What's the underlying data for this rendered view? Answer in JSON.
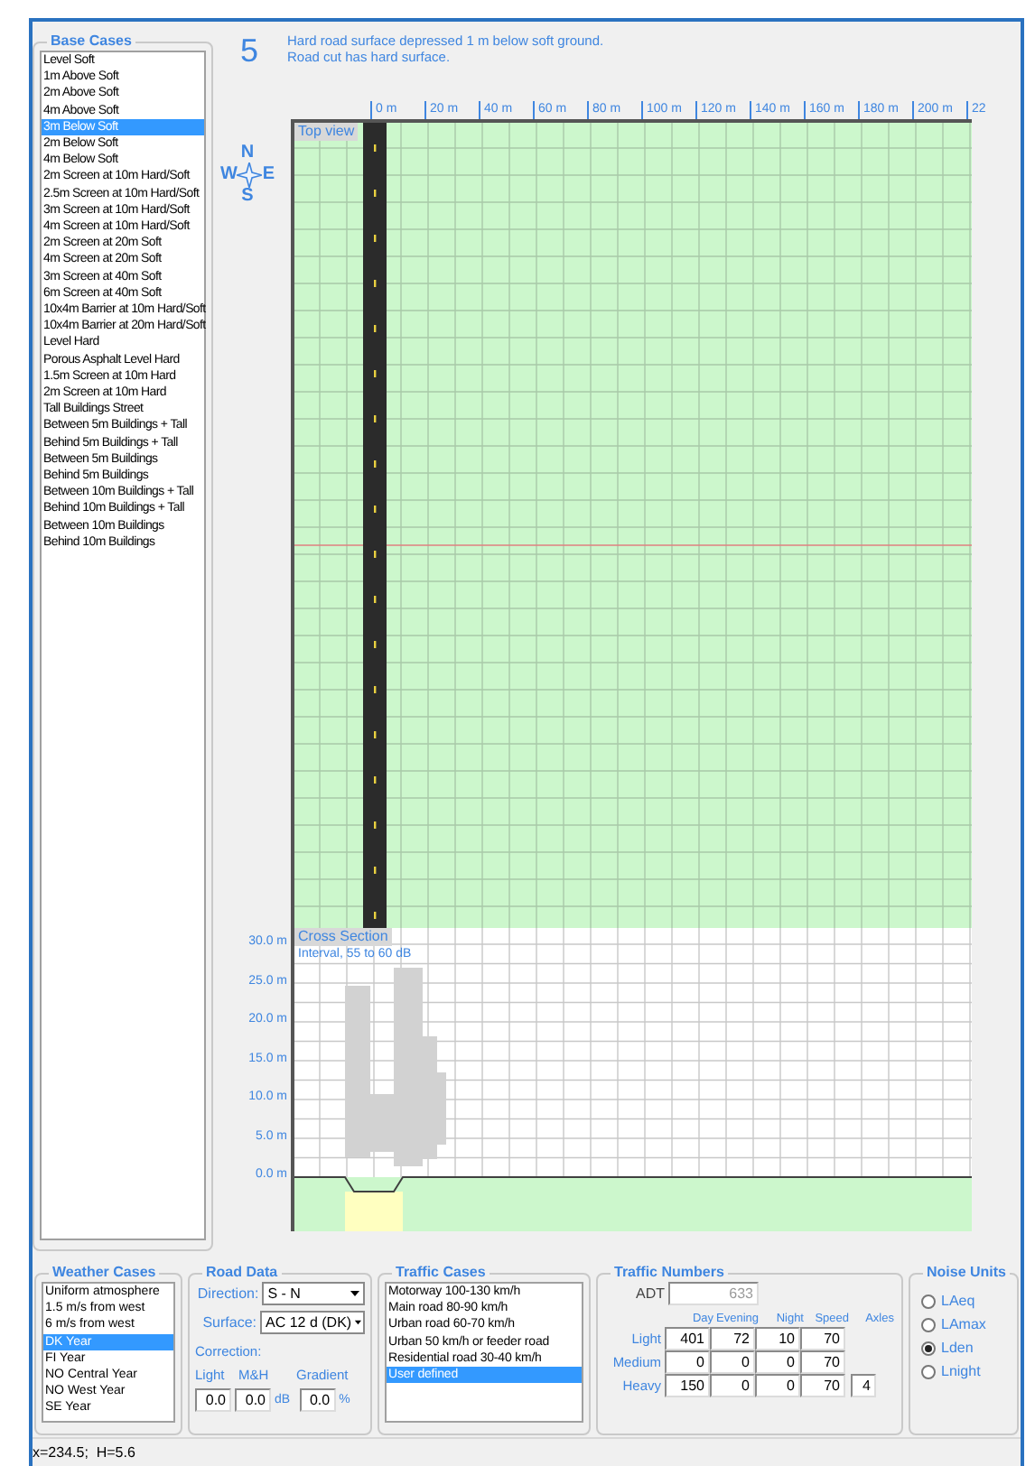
{
  "base_cases": {
    "title": "Base Cases",
    "items": [
      {
        "label": "Level Soft",
        "selected": false
      },
      {
        "label": "1m Above Soft",
        "selected": false
      },
      {
        "label": "2m Above Soft",
        "selected": false
      },
      {
        "label": "4m Above Soft",
        "selected": false
      },
      {
        "label": "3m Below Soft",
        "selected": true
      },
      {
        "label": "2m Below Soft",
        "selected": false
      },
      {
        "label": "4m Below Soft",
        "selected": false
      },
      {
        "label": "2m Screen at 10m Hard/Soft",
        "selected": false
      },
      {
        "label": "2.5m Screen at 10m Hard/Soft",
        "selected": false
      },
      {
        "label": "3m Screen at 10m Hard/Soft",
        "selected": false
      },
      {
        "label": "4m Screen at 10m Hard/Soft",
        "selected": false
      },
      {
        "label": "2m Screen at 20m Soft",
        "selected": false
      },
      {
        "label": "4m Screen at 20m Soft",
        "selected": false
      },
      {
        "label": "3m Screen at 40m Soft",
        "selected": false
      },
      {
        "label": "6m Screen at 40m Soft",
        "selected": false
      },
      {
        "label": "10x4m Barrier at 10m Hard/Soft",
        "selected": false
      },
      {
        "label": "10x4m Barrier at 20m Hard/Soft",
        "selected": false
      },
      {
        "label": "Level Hard",
        "selected": false
      },
      {
        "label": "Porous Asphalt Level Hard",
        "selected": false
      },
      {
        "label": "1.5m Screen at 10m Hard",
        "selected": false
      },
      {
        "label": "2m Screen at 10m Hard",
        "selected": false
      },
      {
        "label": "Tall Buildings Street",
        "selected": false
      },
      {
        "label": "Between 5m Buildings + Tall",
        "selected": false
      },
      {
        "label": "Behind  5m Buildings + Tall",
        "selected": false
      },
      {
        "label": "Between 5m Buildings",
        "selected": false
      },
      {
        "label": "Behind  5m Buildings",
        "selected": false
      },
      {
        "label": "Between 10m Buildings + Tall",
        "selected": false
      },
      {
        "label": "Behind  10m Buildings + Tall",
        "selected": false
      },
      {
        "label": "Between 10m Buildings",
        "selected": false
      },
      {
        "label": "Behind  10m Buildings",
        "selected": false
      }
    ]
  },
  "scenario": {
    "number": "5",
    "description": [
      "Hard road surface depressed 1 m below soft ground.",
      "Road cut has hard surface."
    ]
  },
  "compass": {
    "north": "N",
    "west": "W",
    "east": "E",
    "south": "S"
  },
  "top_view": {
    "label": "Top view",
    "ruler": [
      "0 m",
      "20 m",
      "40 m",
      "60 m",
      "80 m",
      "100 m",
      "120 m",
      "140 m",
      "160 m",
      "180 m",
      "200 m",
      "22"
    ]
  },
  "cross_section": {
    "title": "Cross Section",
    "interval": "Interval, 55 to 60 dB",
    "y_labels": [
      "30.0 m",
      "25.0 m",
      "20.0 m",
      "15.0 m",
      "10.0 m",
      "5.0 m",
      "0.0 m"
    ]
  },
  "weather_cases": {
    "title": "Weather Cases",
    "items": [
      {
        "label": "Uniform atmosphere",
        "selected": false
      },
      {
        "label": "1.5 m/s from west",
        "selected": false
      },
      {
        "label": "6 m/s from west",
        "selected": false
      },
      {
        "label": "DK Year",
        "selected": true
      },
      {
        "label": "FI Year",
        "selected": false
      },
      {
        "label": "NO Central Year",
        "selected": false
      },
      {
        "label": "NO West Year",
        "selected": false
      },
      {
        "label": "SE Year",
        "selected": false
      }
    ]
  },
  "road_data": {
    "title": "Road Data",
    "direction_label": "Direction:",
    "direction": "S - N",
    "surface_label": "Surface:",
    "surface": "AC 12 d (DK)",
    "correction_label": "Correction:",
    "columns": [
      "Light",
      "M&H",
      "Gradient"
    ],
    "light": "0.0",
    "mh": "0.0",
    "db_unit": "dB",
    "gradient": "0.0",
    "percent_unit": "%"
  },
  "traffic_cases": {
    "title": "Traffic Cases",
    "items": [
      {
        "label": "Motorway 100-130 km/h",
        "selected": false
      },
      {
        "label": "Main road 80-90 km/h",
        "selected": false
      },
      {
        "label": "Urban road 60-70 km/h",
        "selected": false
      },
      {
        "label": "Urban 50 km/h or feeder road",
        "selected": false
      },
      {
        "label": "Residential road 30-40 km/h",
        "selected": false
      },
      {
        "label": "User defined",
        "selected": true
      }
    ]
  },
  "traffic_numbers": {
    "title": "Traffic Numbers",
    "adt_label": "ADT",
    "adt": "633",
    "columns": [
      "Day",
      "Evening",
      "Night",
      "Speed",
      "Axles"
    ],
    "rows": [
      {
        "label": "Light",
        "values": [
          "401",
          "72",
          "10",
          "70"
        ]
      },
      {
        "label": "Medium",
        "values": [
          "0",
          "0",
          "0",
          "70"
        ]
      },
      {
        "label": "Heavy",
        "values": [
          "150",
          "0",
          "0",
          "70"
        ],
        "axles": "4"
      }
    ]
  },
  "noise_units": {
    "title": "Noise Units",
    "options": [
      {
        "label": "LAeq",
        "selected": false
      },
      {
        "label": "LAmax",
        "selected": false
      },
      {
        "label": "Lden",
        "selected": true
      },
      {
        "label": "Lnight",
        "selected": false
      }
    ]
  },
  "status_bar": "x=234.5;  H=5.6"
}
